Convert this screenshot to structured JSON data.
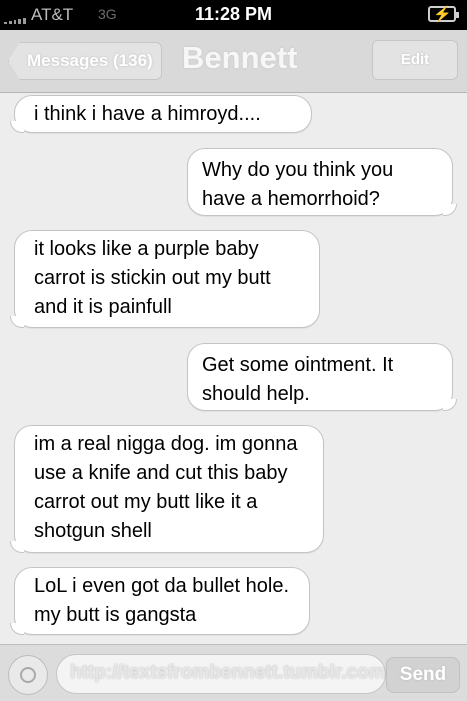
{
  "status_bar": {
    "carrier": "AT&T",
    "network": "3G",
    "time": "11:28 PM",
    "battery_icon": "battery-charging-icon",
    "signal_icon": "signal-bars-icon"
  },
  "nav": {
    "back_label": "Messages (136)",
    "title": "Bennett",
    "edit_label": "Edit"
  },
  "messages": [
    {
      "from": "them",
      "text": "i think i have a himroyd...."
    },
    {
      "from": "me",
      "text": "Why do you think you have a hemorrhoid?"
    },
    {
      "from": "them",
      "text": "it looks like a purple baby carrot is stickin out my butt and it is painfull"
    },
    {
      "from": "me",
      "text": "Get some ointment. It should help."
    },
    {
      "from": "them",
      "text": "im a real nigga dog. im gonna use a knife and cut this baby carrot out my butt like it a shotgun shell"
    },
    {
      "from": "them",
      "text": "LoL i even got da bullet hole. my butt is gangsta"
    }
  ],
  "composer": {
    "camera_icon": "camera-icon",
    "watermark": "http://textsfrombennett.tumblr.com",
    "send_label": "Send"
  },
  "colors": {
    "background": "#ededed",
    "bubble": "#ffffff",
    "status_bar": "#000000"
  }
}
